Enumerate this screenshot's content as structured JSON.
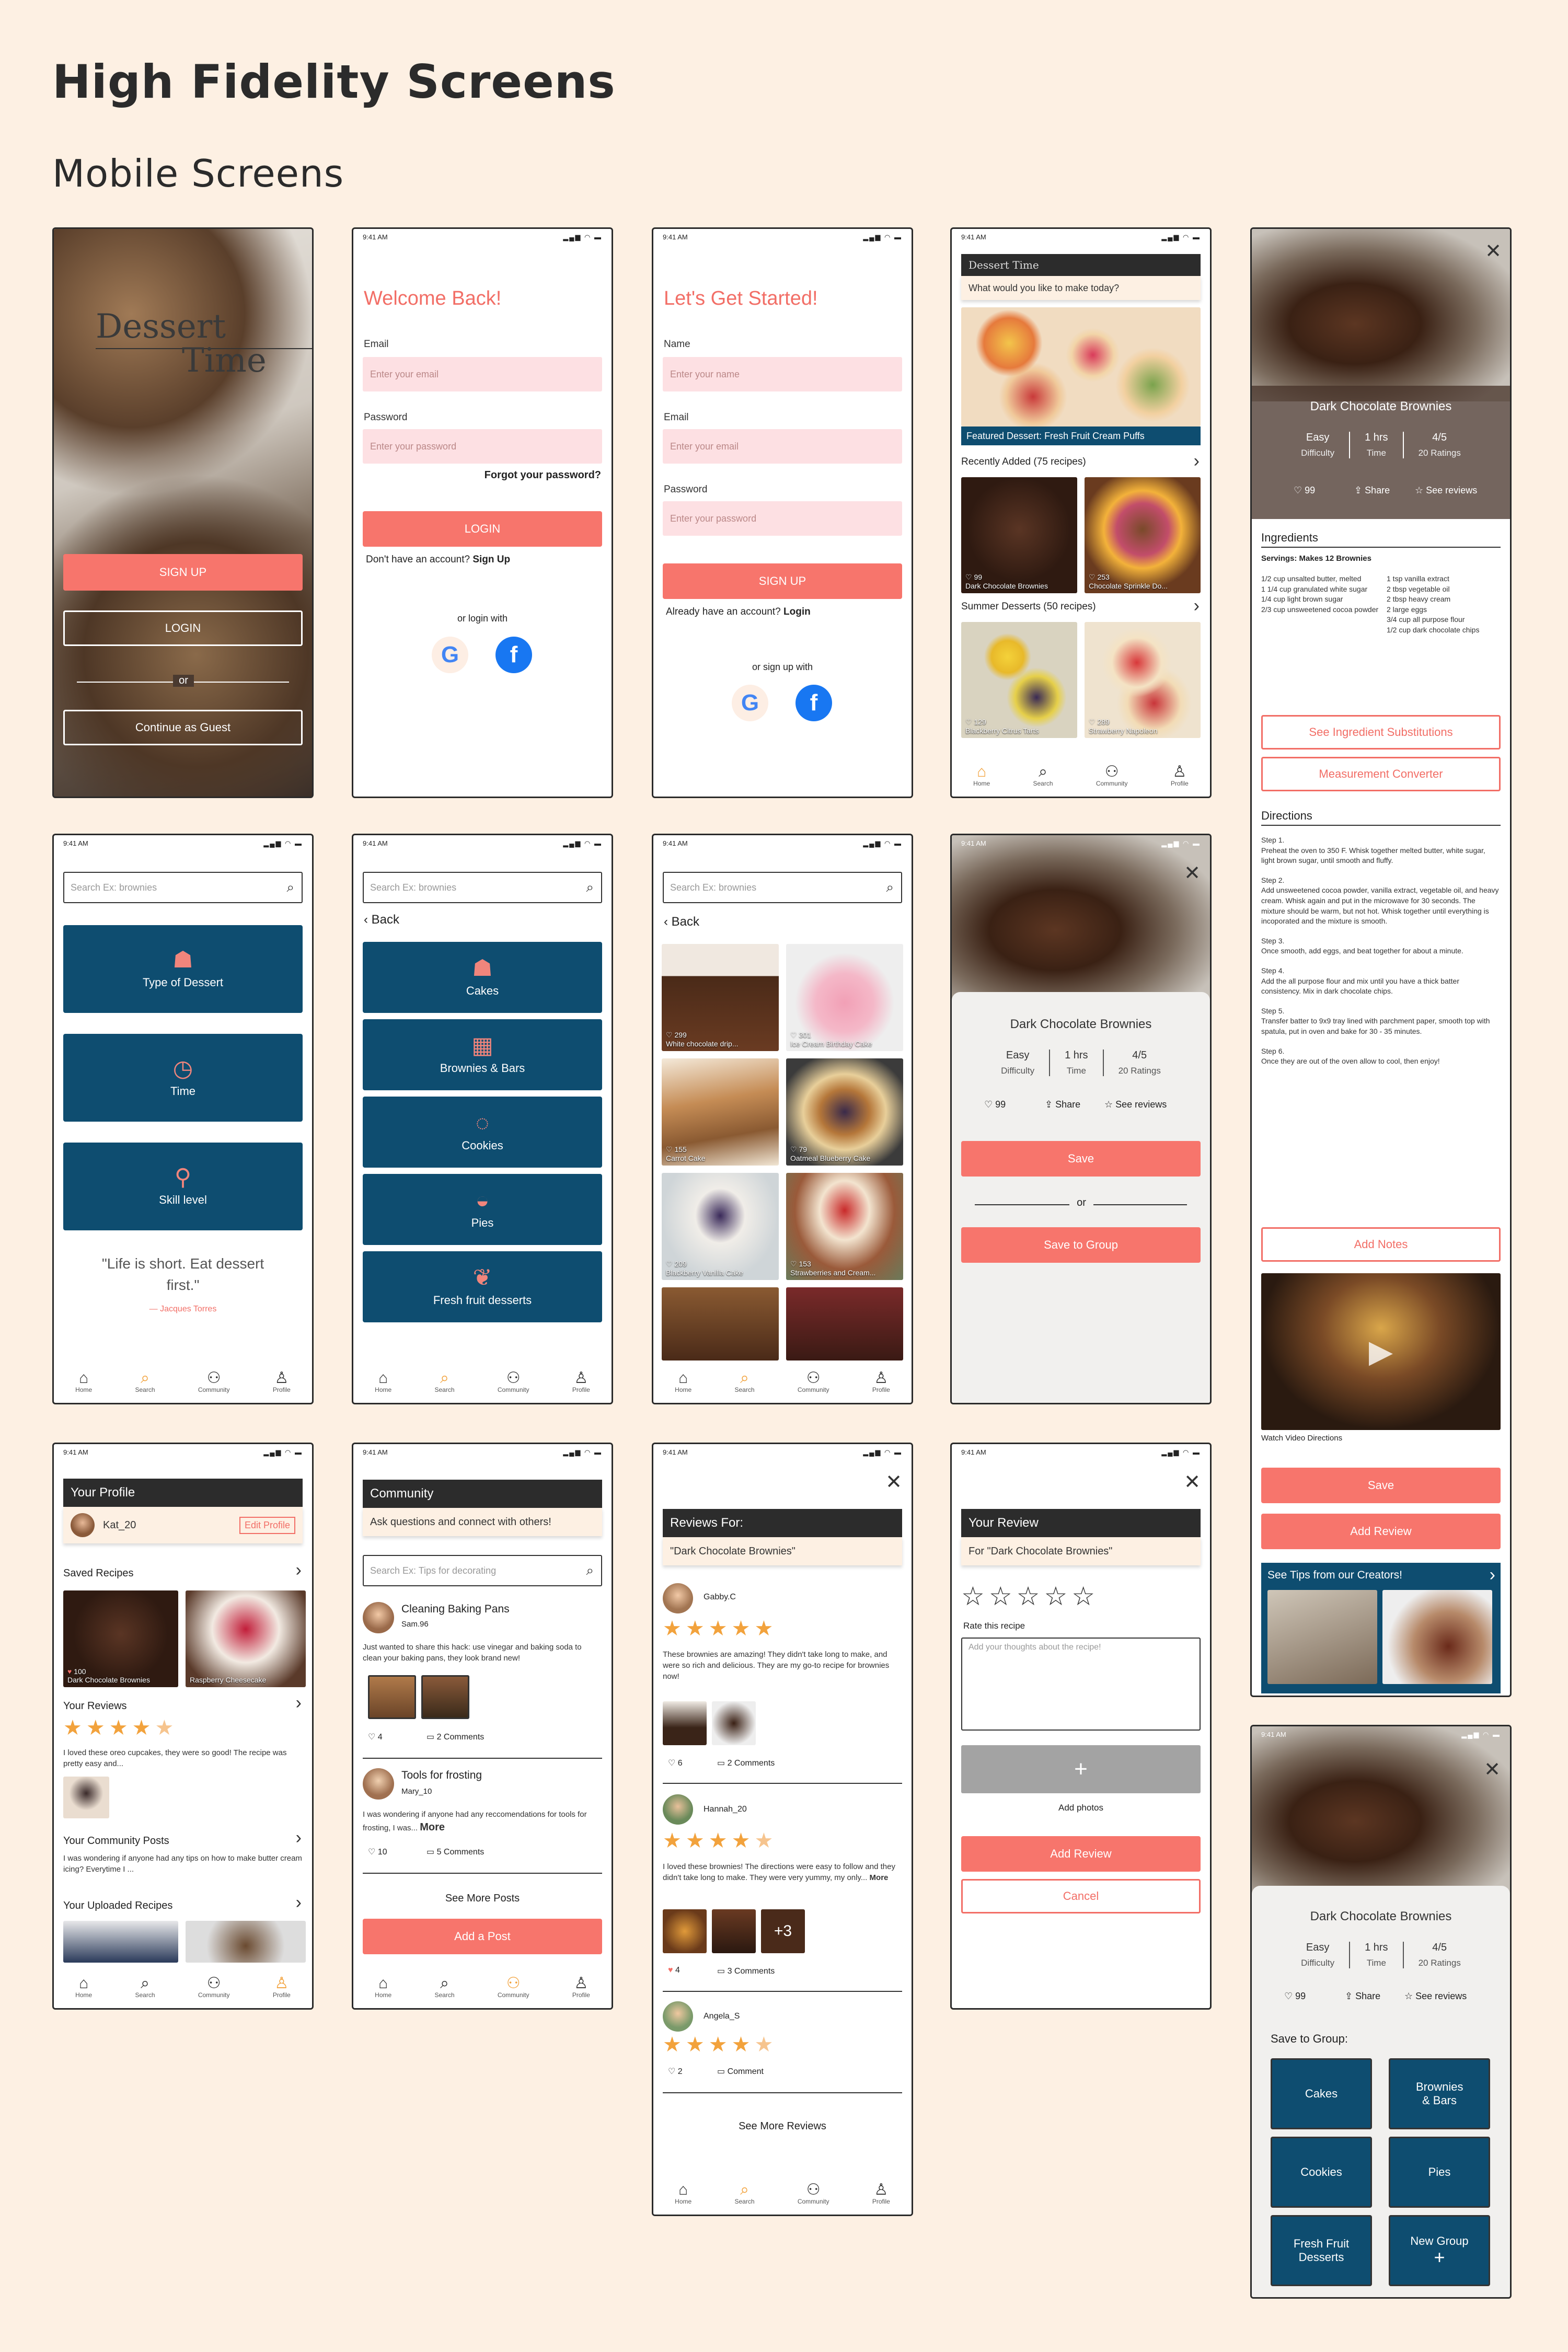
{
  "page": {
    "title": "High Fidelity Screens",
    "subtitle": "Mobile Screens"
  },
  "status": {
    "time": "9:41 AM",
    "icons": "▂▄▆ ◠ ▬"
  },
  "nav": {
    "home": "Home",
    "search": "Search",
    "community": "Community",
    "profile": "Profile"
  },
  "splash": {
    "brand1": "Dessert",
    "brand2": "Time",
    "signup": "SIGN UP",
    "login": "LOGIN",
    "or": "or",
    "guest": "Continue as Guest"
  },
  "login": {
    "title": "Welcome Back!",
    "email_label": "Email",
    "email_ph": "Enter your email",
    "password_label": "Password",
    "password_ph": "Enter your password",
    "forgot": "Forgot your password?",
    "button": "LOGIN",
    "no_account": "Don't have an account?",
    "signup_link": "Sign Up",
    "or_login": "or login with"
  },
  "signup": {
    "title": "Let's Get Started!",
    "name_label": "Name",
    "name_ph": "Enter your name",
    "email_label": "Email",
    "email_ph": "Enter your email",
    "password_label": "Password",
    "password_ph": "Enter your password",
    "button": "SIGN UP",
    "have_account": "Already have an account?",
    "login_link": "Login",
    "or_signup": "or sign up with"
  },
  "home": {
    "brand": "Dessert Time",
    "prompt": "What would you like to make today?",
    "featured": "Featured Dessert: Fresh Fruit Cream Puffs",
    "recent": "Recently Added (75 recipes)",
    "summer": "Summer Desserts (50 recipes)",
    "cards": [
      {
        "likes": "99",
        "name": "Dark Chocolate Brownies"
      },
      {
        "likes": "253",
        "name": "Chocolate Sprinkle Do..."
      },
      {
        "likes": "129",
        "name": "Blackberry Citrus Tarts"
      },
      {
        "likes": "289",
        "name": "Strawberry Napoleon"
      }
    ]
  },
  "recipe": {
    "title": "Dark Chocolate Brownies",
    "difficulty": "Easy",
    "difficulty_lbl": "Difficulty",
    "time": "1 hrs",
    "time_lbl": "Time",
    "rating": "4/5",
    "rating_lbl": "20 Ratings",
    "likes": "99",
    "share": "Share",
    "reviews": "See reviews",
    "ingredients_h": "Ingredients",
    "servings": "Servings: Makes 12 Brownies",
    "ing_left": [
      "1/2 cup unsalted butter, melted",
      "1 1/4 cup granulated white sugar",
      "1/4 cup light brown sugar",
      "2/3 cup unsweetened cocoa powder"
    ],
    "ing_right": [
      "1 tsp vanilla extract",
      "2 tbsp vegetable oil",
      "2 tbsp heavy cream",
      "2 large eggs",
      "3/4 cup all purpose flour",
      "1/2 cup dark chocolate chips"
    ],
    "subs": "See Ingredient Substitutions",
    "converter": "Measurement Converter",
    "directions_h": "Directions",
    "steps": [
      {
        "n": "Step 1.",
        "t": "Preheat the oven to 350 F. Whisk together melted butter, white sugar, light brown sugar, until smooth and fluffy."
      },
      {
        "n": "Step 2.",
        "t": "Add unsweetened cocoa powder, vanilla extract, vegetable oil, and heavy cream. Whisk again and put in the microwave for 30 seconds. The mixture should be warm, but not hot. Whisk together until everything is incoporated and the mixture is smooth."
      },
      {
        "n": "Step 3.",
        "t": "Once smooth, add eggs, and beat together for about a minute."
      },
      {
        "n": "Step 4.",
        "t": "Add the all purpose flour and mix until you have a thick batter consistency. Mix in dark chocolate chips."
      },
      {
        "n": "Step 5.",
        "t": "Transfer batter to 9x9 tray lined with parchment paper, smooth top with spatula, put in oven and bake for 30 - 35 minutes."
      },
      {
        "n": "Step 6.",
        "t": "Once they are out of the oven allow to cool, then enjoy!"
      }
    ],
    "add_notes": "Add Notes",
    "video": "Watch Video Directions",
    "save": "Save",
    "add_review": "Add Review",
    "tips": "See Tips from our Creators!"
  },
  "explore": {
    "search_ph": "Search Ex: brownies",
    "tiles": [
      "Type of Dessert",
      "Time",
      "Skill level"
    ],
    "quote": "\"Life is short. Eat dessert first.\"",
    "author": "— Jacques Torres"
  },
  "types": {
    "back": "Back",
    "tiles": [
      "Cakes",
      "Brownies & Bars",
      "Cookies",
      "Pies",
      "Fresh fruit desserts"
    ]
  },
  "cakes": {
    "back": "Back",
    "items": [
      {
        "likes": "299",
        "name": "White chocolate drip..."
      },
      {
        "likes": "301",
        "name": "Ice Cream Birthday Cake"
      },
      {
        "likes": "155",
        "name": "Carrot Cake"
      },
      {
        "likes": "79",
        "name": "Oatmeal Blueberry Cake"
      },
      {
        "likes": "209",
        "name": "Blackberry Vanilla Cake"
      },
      {
        "likes": "153",
        "name": "Strawberries and Cream..."
      }
    ]
  },
  "savesheet": {
    "save": "Save",
    "or": "or",
    "save_group": "Save to Group"
  },
  "profile": {
    "title": "Your Profile",
    "user": "Kat_20",
    "edit": "Edit Profile",
    "saved": "Saved Recipes",
    "saved_items": [
      {
        "likes": "100",
        "name": "Dark Chocolate Brownies"
      },
      {
        "name": "Raspberry Cheesecake"
      }
    ],
    "reviews_h": "Your Reviews",
    "review_text": "I loved these oreo cupcakes, they were so good! The recipe was pretty easy and...",
    "posts_h": "Your Community Posts",
    "post_text": "I was wondering if anyone had any tips on how to make butter cream icing? Everytime I ...",
    "uploaded_h": "Your Uploaded Recipes"
  },
  "community": {
    "title": "Community",
    "tagline": "Ask questions and connect with others!",
    "search_ph": "Search Ex: Tips for decorating",
    "posts": [
      {
        "title": "Cleaning Baking Pans",
        "user": "Sam.96",
        "text": "Just wanted to share this hack: use vinegar and baking soda to clean your baking pans, they look brand new!",
        "likes": "4",
        "comments": "2 Comments"
      },
      {
        "title": "Tools for frosting",
        "user": "Mary_10",
        "text": "I was wondering if anyone had any reccomendations for tools for frosting, I was...",
        "more": "More",
        "likes": "10",
        "comments": "5 Comments"
      }
    ],
    "see_more": "See More Posts",
    "add": "Add a Post"
  },
  "reviews": {
    "title": "Reviews For:",
    "recipe": "\"Dark Chocolate Brownies\"",
    "items": [
      {
        "user": "Gabby.C",
        "text": "These brownies are amazing! They didn't take long to make, and were so rich and delicious. They are my go-to recipe for brownies now!",
        "likes": "6",
        "comments": "2 Comments"
      },
      {
        "user": "Hannah_20",
        "text": "I loved these brownies! The directions were easy to follow and they didn't take long to make. They were very yummy, my only...",
        "more": "More",
        "likes": "4",
        "comments": "3 Comments",
        "extra": "+3"
      },
      {
        "user": "Angela_S",
        "likes": "2",
        "comments": "Comment"
      }
    ],
    "see_more": "See More Reviews"
  },
  "yourreview": {
    "title": "Your Review",
    "for": "For \"Dark Chocolate Brownies\"",
    "rate": "Rate this recipe",
    "ph": "Add your thoughts about the recipe!",
    "photos": "Add photos",
    "add": "Add Review",
    "cancel": "Cancel"
  },
  "group": {
    "save_to": "Save to Group:",
    "tiles": [
      "Cakes",
      "Brownies & Bars",
      "Cookies",
      "Pies",
      "Fresh Fruit Desserts",
      "New Group"
    ]
  }
}
